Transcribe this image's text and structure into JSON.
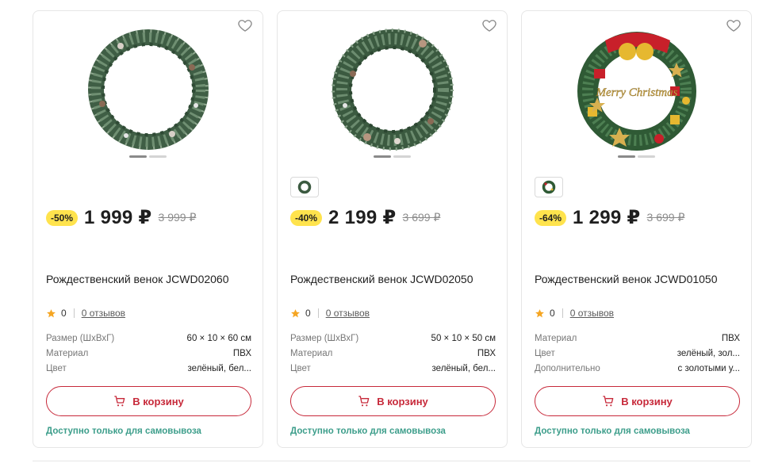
{
  "colors": {
    "accent_red": "#c7293a",
    "discount_yellow": "#ffe34d",
    "pickup_green": "#3d9e8b",
    "star_orange": "#f5a623"
  },
  "products": [
    {
      "discount": "-50%",
      "price": "1 999 ₽",
      "old_price": "3 999 ₽",
      "title": "Рождественский венок JCWD02060",
      "rating": "0",
      "reviews": "0 отзывов",
      "has_variant": false,
      "image": "wreath-plain-icon",
      "props": [
        {
          "k": "Размер (ШхВхГ)",
          "v": "60 × 10 × 60 см"
        },
        {
          "k": "Материал",
          "v": "ПВХ"
        },
        {
          "k": "Цвет",
          "v": "зелёный, бел..."
        }
      ],
      "cart_label": "В корзину",
      "pickup": "Доступно только для самовывоза"
    },
    {
      "discount": "-40%",
      "price": "2 199 ₽",
      "old_price": "3 699 ₽",
      "title": "Рождественский венок JCWD02050",
      "rating": "0",
      "reviews": "0 отзывов",
      "has_variant": true,
      "image": "wreath-plain-icon",
      "props": [
        {
          "k": "Размер (ШхВхГ)",
          "v": "50 × 10 × 50 см"
        },
        {
          "k": "Материал",
          "v": "ПВХ"
        },
        {
          "k": "Цвет",
          "v": "зелёный, бел..."
        }
      ],
      "cart_label": "В корзину",
      "pickup": "Доступно только для самовывоза"
    },
    {
      "discount": "-64%",
      "price": "1 299 ₽",
      "old_price": "3 699 ₽",
      "title": "Рождественский венок JCWD01050",
      "rating": "0",
      "reviews": "0 отзывов",
      "has_variant": true,
      "image": "wreath-decorated-icon",
      "image_text": "Merry Christmas",
      "props": [
        {
          "k": "Материал",
          "v": "ПВХ"
        },
        {
          "k": "Цвет",
          "v": "зелёный, зол..."
        },
        {
          "k": "Дополнительно",
          "v": "с золотыми у..."
        }
      ],
      "cart_label": "В корзину",
      "pickup": "Доступно только для самовывоза"
    }
  ]
}
